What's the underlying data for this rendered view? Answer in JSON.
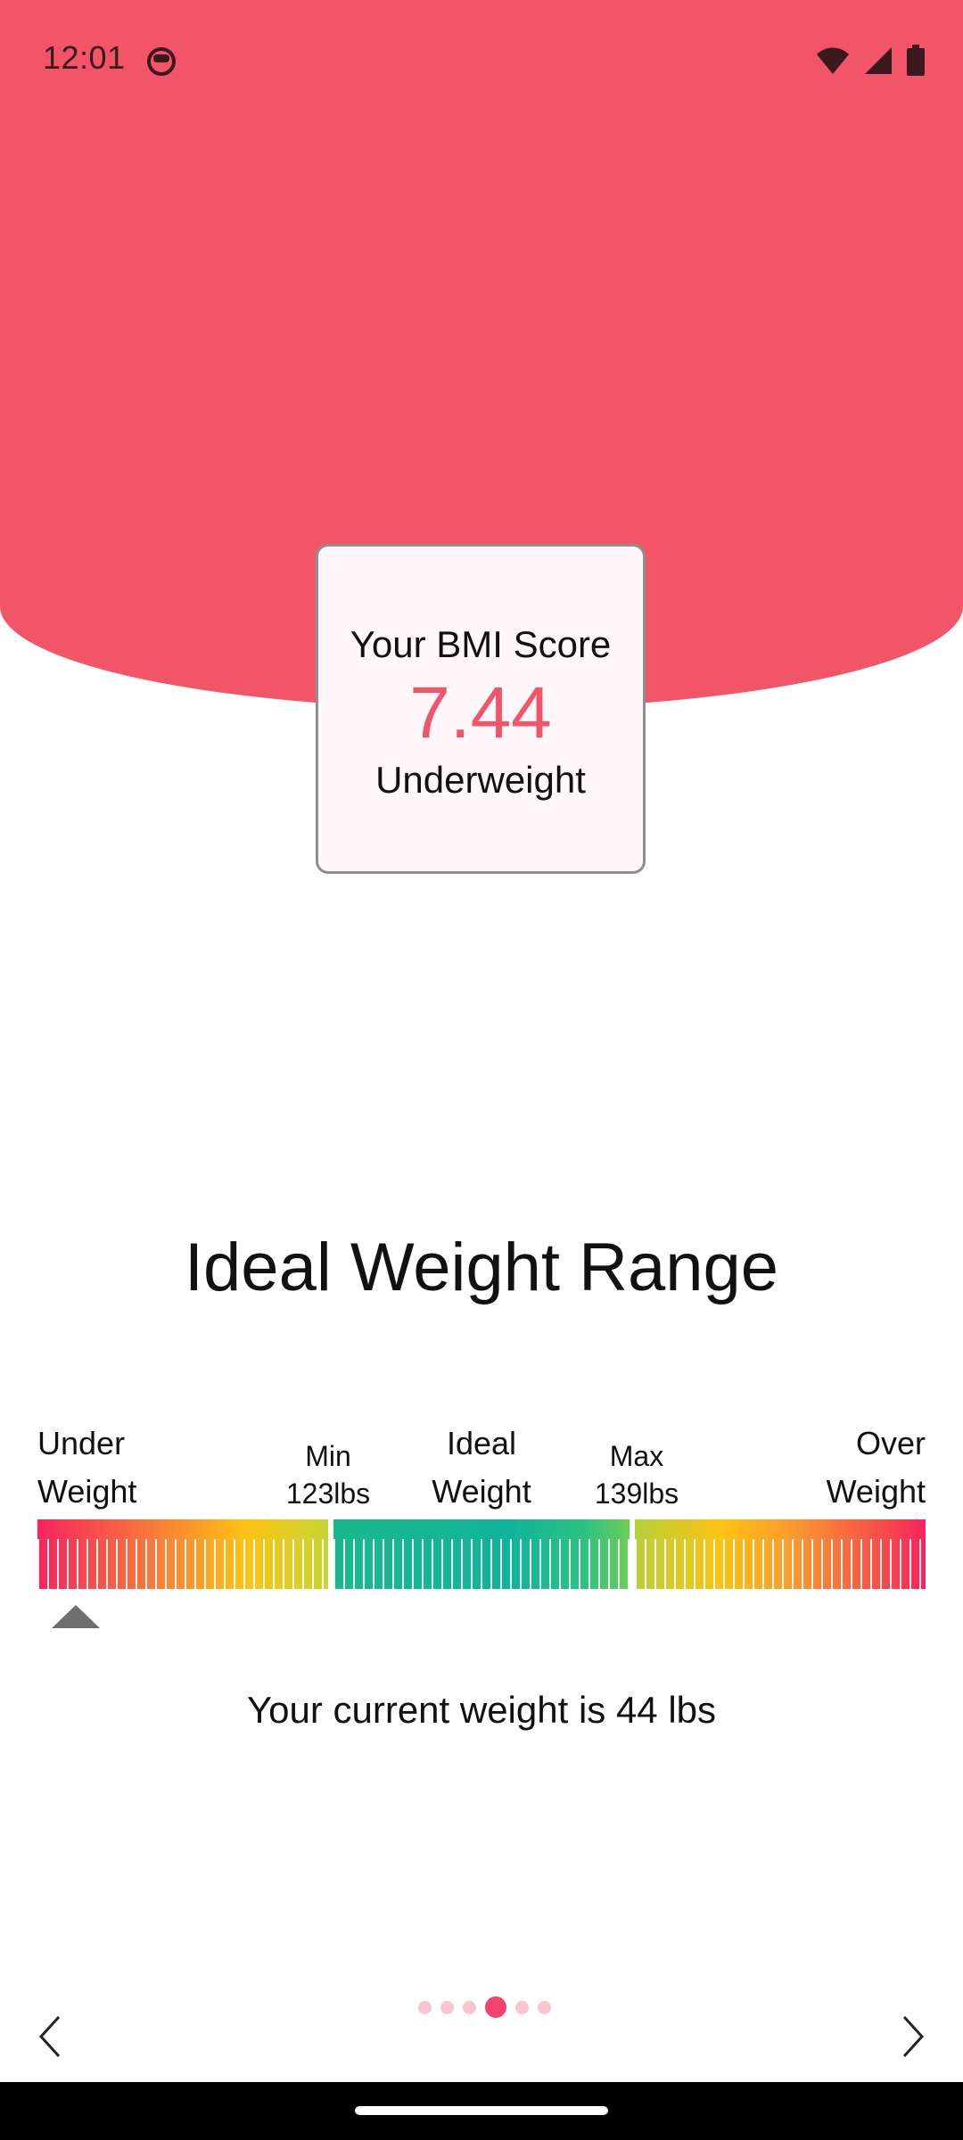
{
  "status_bar": {
    "time": "12:01",
    "face_icon": "face-icon",
    "wifi_icon": "wifi-icon",
    "signal_icon": "signal-icon",
    "battery_icon": "battery-icon"
  },
  "bmi": {
    "title": "Your BMI Score",
    "score": "7.44",
    "category": "Underweight"
  },
  "ideal_range": {
    "title": "Ideal Weight Range",
    "under": "Under\nWeight",
    "min_label": "Min",
    "min_value": "123",
    "min_unit": "lbs",
    "ideal": "Ideal\nWeight",
    "max_label": "Max",
    "max_value": "139",
    "max_unit": "lbs",
    "over": "Over\nWeight",
    "current_weight_text": "Your current weight is 44  lbs"
  },
  "pager": {
    "total": 6,
    "active_index": 3
  },
  "navigation": {
    "prev_icon": "chevron-left-icon",
    "next_icon": "chevron-right-icon"
  },
  "colors": {
    "accent": "#f25567",
    "active_dot": "#f4426c",
    "inactive_dot": "#f8c6d1"
  }
}
